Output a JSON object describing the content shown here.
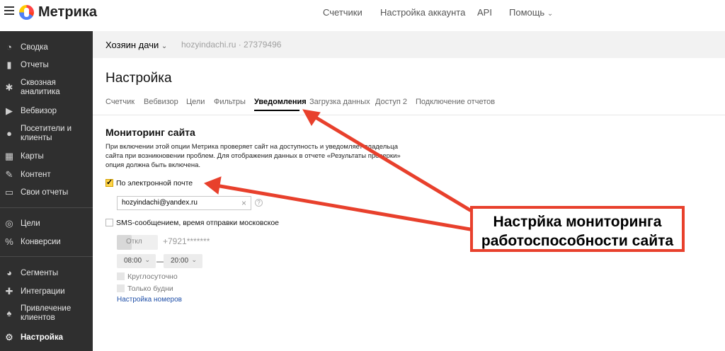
{
  "app": {
    "logo_text": "Метрика",
    "nav": [
      "Счетчики",
      "Настройка аккаунта",
      "API",
      "Помощь"
    ],
    "nav_help_chevron": "chevron-down-icon"
  },
  "sidebar": {
    "items": [
      {
        "label": "Сводка",
        "icon": "dashboard-icon"
      },
      {
        "label": "Отчеты",
        "icon": "bar-chart-icon"
      },
      {
        "label": "Сквозная аналитика",
        "icon": "snowflake-icon"
      },
      {
        "label": "Вебвизор",
        "icon": "play-icon"
      },
      {
        "label": "Посетители и клиенты",
        "icon": "person-icon"
      },
      {
        "label": "Карты",
        "icon": "map-icon"
      },
      {
        "label": "Контент",
        "icon": "pencil-icon"
      },
      {
        "label": "Свои отчеты",
        "icon": "report-icon"
      },
      {
        "label": "Цели",
        "icon": "target-icon"
      },
      {
        "label": "Конверсии",
        "icon": "percent-icon"
      },
      {
        "label": "Сегменты",
        "icon": "pie-icon"
      },
      {
        "label": "Интеграции",
        "icon": "puzzle-icon"
      },
      {
        "label": "Привлечение клиентов",
        "icon": "flame-icon"
      },
      {
        "label": "Настройка",
        "icon": "gear-icon",
        "active": true
      }
    ]
  },
  "header": {
    "counter_name": "Хозяин дачи",
    "site_info": "hozyindachi.ru · 27379496"
  },
  "page": {
    "title": "Настройка",
    "tabs": [
      "Счетчик",
      "Вебвизор",
      "Цели",
      "Фильтры",
      "Уведомления",
      "Загрузка данных",
      "Доступ 2",
      "Подключение отчетов"
    ],
    "active_tab": "Уведомления"
  },
  "monitoring": {
    "title": "Мониторинг сайта",
    "description": "При включении этой опции Метрика проверяет сайт на доступность и уведомляет владельца сайта при возникновении проблем. Для отображения данных в отчете «Результаты проверки» опция должна быть включена.",
    "email_option": {
      "label": "По электронной почте",
      "checked": true
    },
    "email_value": "hozyindachi@yandex.ru",
    "sms_option": {
      "label": "SMS-сообщением, время отправки московское",
      "checked": false
    },
    "toggle_label": "Откл",
    "phone": "+7921*******",
    "time_from": "08:00",
    "time_dash": "—",
    "time_to": "20:00",
    "round_clock": "Круглосуточно",
    "weekdays_only": "Только будни",
    "numbers_link": "Настройка номеров"
  },
  "annotation": {
    "callout_text": "Настрйка мониторинга работоспособности сайта",
    "color": "#e8402c"
  }
}
